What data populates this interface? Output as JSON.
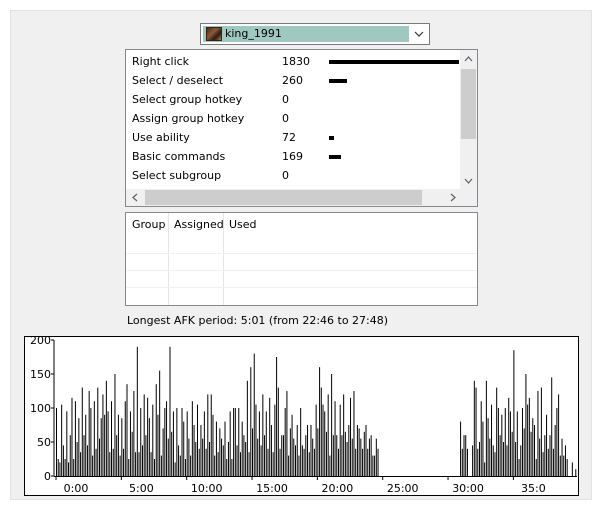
{
  "player": {
    "name": "king_1991"
  },
  "actions": [
    {
      "label": "Right click",
      "count": "1830",
      "value": 1830
    },
    {
      "label": "Select / deselect",
      "count": "260",
      "value": 260
    },
    {
      "label": "Select group hotkey",
      "count": "0",
      "value": 0
    },
    {
      "label": "Assign group hotkey",
      "count": "0",
      "value": 0
    },
    {
      "label": "Use ability",
      "count": "72",
      "value": 72
    },
    {
      "label": "Basic commands",
      "count": "169",
      "value": 169
    },
    {
      "label": "Select subgroup",
      "count": "0",
      "value": 0
    }
  ],
  "group_table": {
    "columns": [
      "Group",
      "Assigned",
      "Used"
    ]
  },
  "afk_text": "Longest AFK period: 5:01 (from 22:46 to 27:48)",
  "chart_data": {
    "type": "bar",
    "ylim": [
      0,
      200
    ],
    "yticks": [
      "0",
      "50",
      "100",
      "150",
      "200"
    ],
    "xticks": [
      "0:00",
      "5:00",
      "10:00",
      "15:00",
      "20:00",
      "25:00",
      "30:00",
      "35:0"
    ],
    "grid": false,
    "values": [
      100,
      25,
      20,
      105,
      45,
      25,
      95,
      20,
      60,
      115,
      25,
      110,
      50,
      85,
      35,
      130,
      60,
      90,
      45,
      125,
      100,
      30,
      110,
      40,
      130,
      55,
      85,
      120,
      90,
      140,
      95,
      35,
      110,
      40,
      150,
      60,
      90,
      30,
      85,
      40,
      110,
      135,
      25,
      95,
      65,
      125,
      35,
      190,
      35,
      100,
      45,
      120,
      60,
      115,
      85,
      35,
      105,
      25,
      135,
      90,
      155,
      30,
      70,
      100,
      110,
      55,
      190,
      65,
      95,
      20,
      100,
      45,
      30,
      100,
      80,
      25,
      95,
      55,
      30,
      110,
      75,
      50,
      105,
      40,
      75,
      55,
      95,
      40,
      120,
      50,
      120,
      90,
      30,
      80,
      35,
      70,
      55,
      45,
      80,
      25,
      50,
      95,
      25,
      100,
      100,
      45,
      100,
      35,
      80,
      60,
      50,
      140,
      35,
      160,
      70,
      180,
      105,
      55,
      95,
      45,
      120,
      60,
      95,
      40,
      115,
      75,
      35,
      105,
      175,
      130,
      40,
      60,
      60,
      100,
      125,
      30,
      70,
      90,
      55,
      45,
      75,
      30,
      100,
      45,
      40,
      60,
      75,
      35,
      75,
      55,
      40,
      105,
      70,
      160,
      130,
      105,
      95,
      65,
      120,
      30,
      150,
      60,
      110,
      60,
      40,
      105,
      60,
      120,
      65,
      50,
      75,
      115,
      55,
      125,
      40,
      75,
      70,
      55,
      40,
      65,
      75,
      40,
      55,
      60,
      30,
      30,
      55,
      40,
      0,
      0,
      0,
      0,
      0,
      0,
      0,
      0,
      0,
      0,
      0,
      0,
      0,
      0,
      0,
      0,
      0,
      0,
      0,
      0,
      0,
      0,
      0,
      0,
      0,
      0,
      0,
      0,
      0,
      0,
      0,
      0,
      0,
      0,
      0,
      0,
      0,
      0,
      0,
      0,
      0,
      0,
      0,
      0,
      0,
      0,
      0,
      80,
      40,
      60,
      60,
      40,
      0,
      0,
      45,
      140,
      130,
      40,
      50,
      110,
      80,
      20,
      140,
      85,
      55,
      105,
      45,
      35,
      130,
      100,
      60,
      90,
      50,
      100,
      45,
      115,
      95,
      65,
      185,
      50,
      95,
      25,
      45,
      100,
      70,
      150,
      105,
      115,
      65,
      85,
      75,
      25,
      125,
      55,
      130,
      35,
      60,
      90,
      40,
      60,
      145,
      40,
      75,
      100,
      120,
      30,
      55,
      30,
      45,
      25,
      0,
      0,
      20,
      0,
      10
    ]
  }
}
